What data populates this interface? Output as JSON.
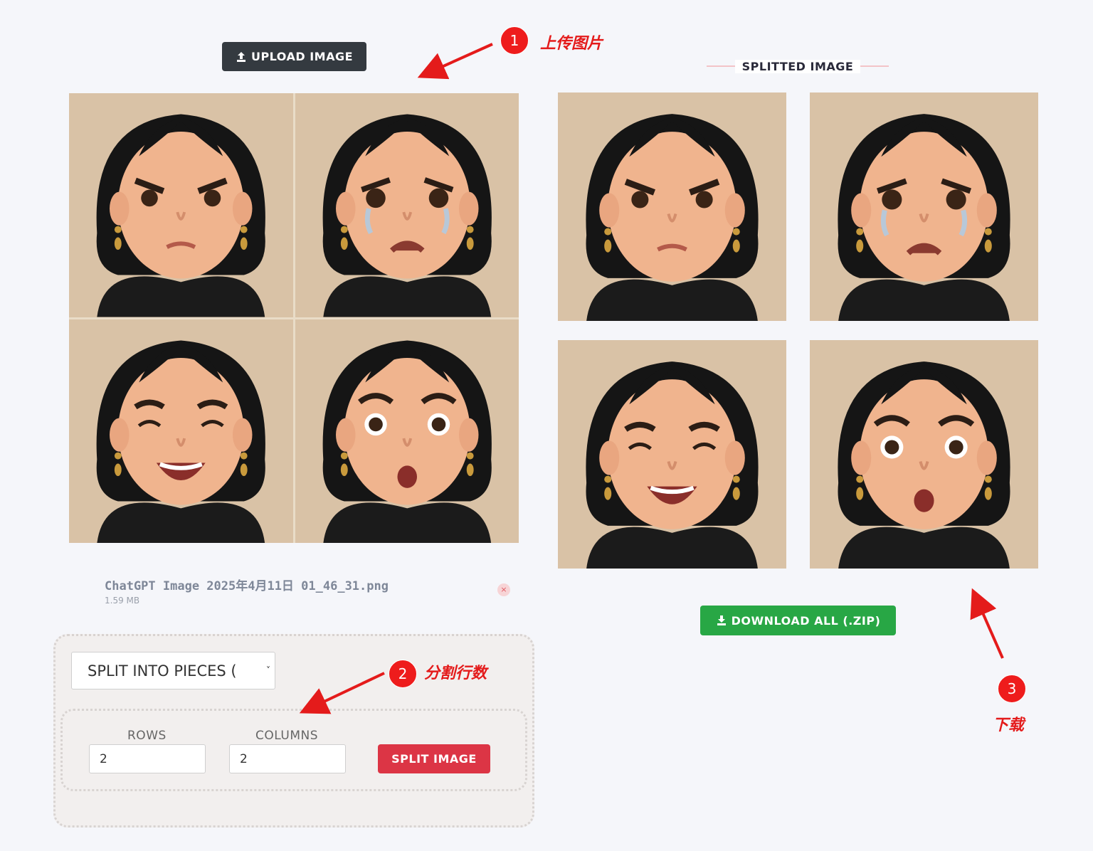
{
  "upload_button": {
    "label": "UPLOAD IMAGE",
    "icon": "upload-icon"
  },
  "file": {
    "name": "ChatGPT Image 2025年4月11日 01_46_31.png",
    "size": "1.59 MB",
    "remove_icon": "×"
  },
  "options": {
    "mode_selected": "SPLIT INTO PIECES (",
    "rows_label": "ROWS",
    "rows_value": "2",
    "columns_label": "COLUMNS",
    "columns_value": "2",
    "split_button": "SPLIT IMAGE"
  },
  "result": {
    "title": "SPLITTED IMAGE",
    "download_button": "DOWNLOAD ALL (.ZIP)"
  },
  "annotations": [
    {
      "number": "1",
      "text": "上传图片"
    },
    {
      "number": "2",
      "text": "分割行数"
    },
    {
      "number": "3",
      "text": "下载"
    }
  ],
  "faces": [
    "angry",
    "crying",
    "laughing",
    "surprised"
  ],
  "colors": {
    "accent_dark": "#343a40",
    "split_red": "#dc3545",
    "download_green": "#28a745",
    "annotation_red": "#ee1c1c",
    "tile_bg": "#d9c2a6"
  }
}
